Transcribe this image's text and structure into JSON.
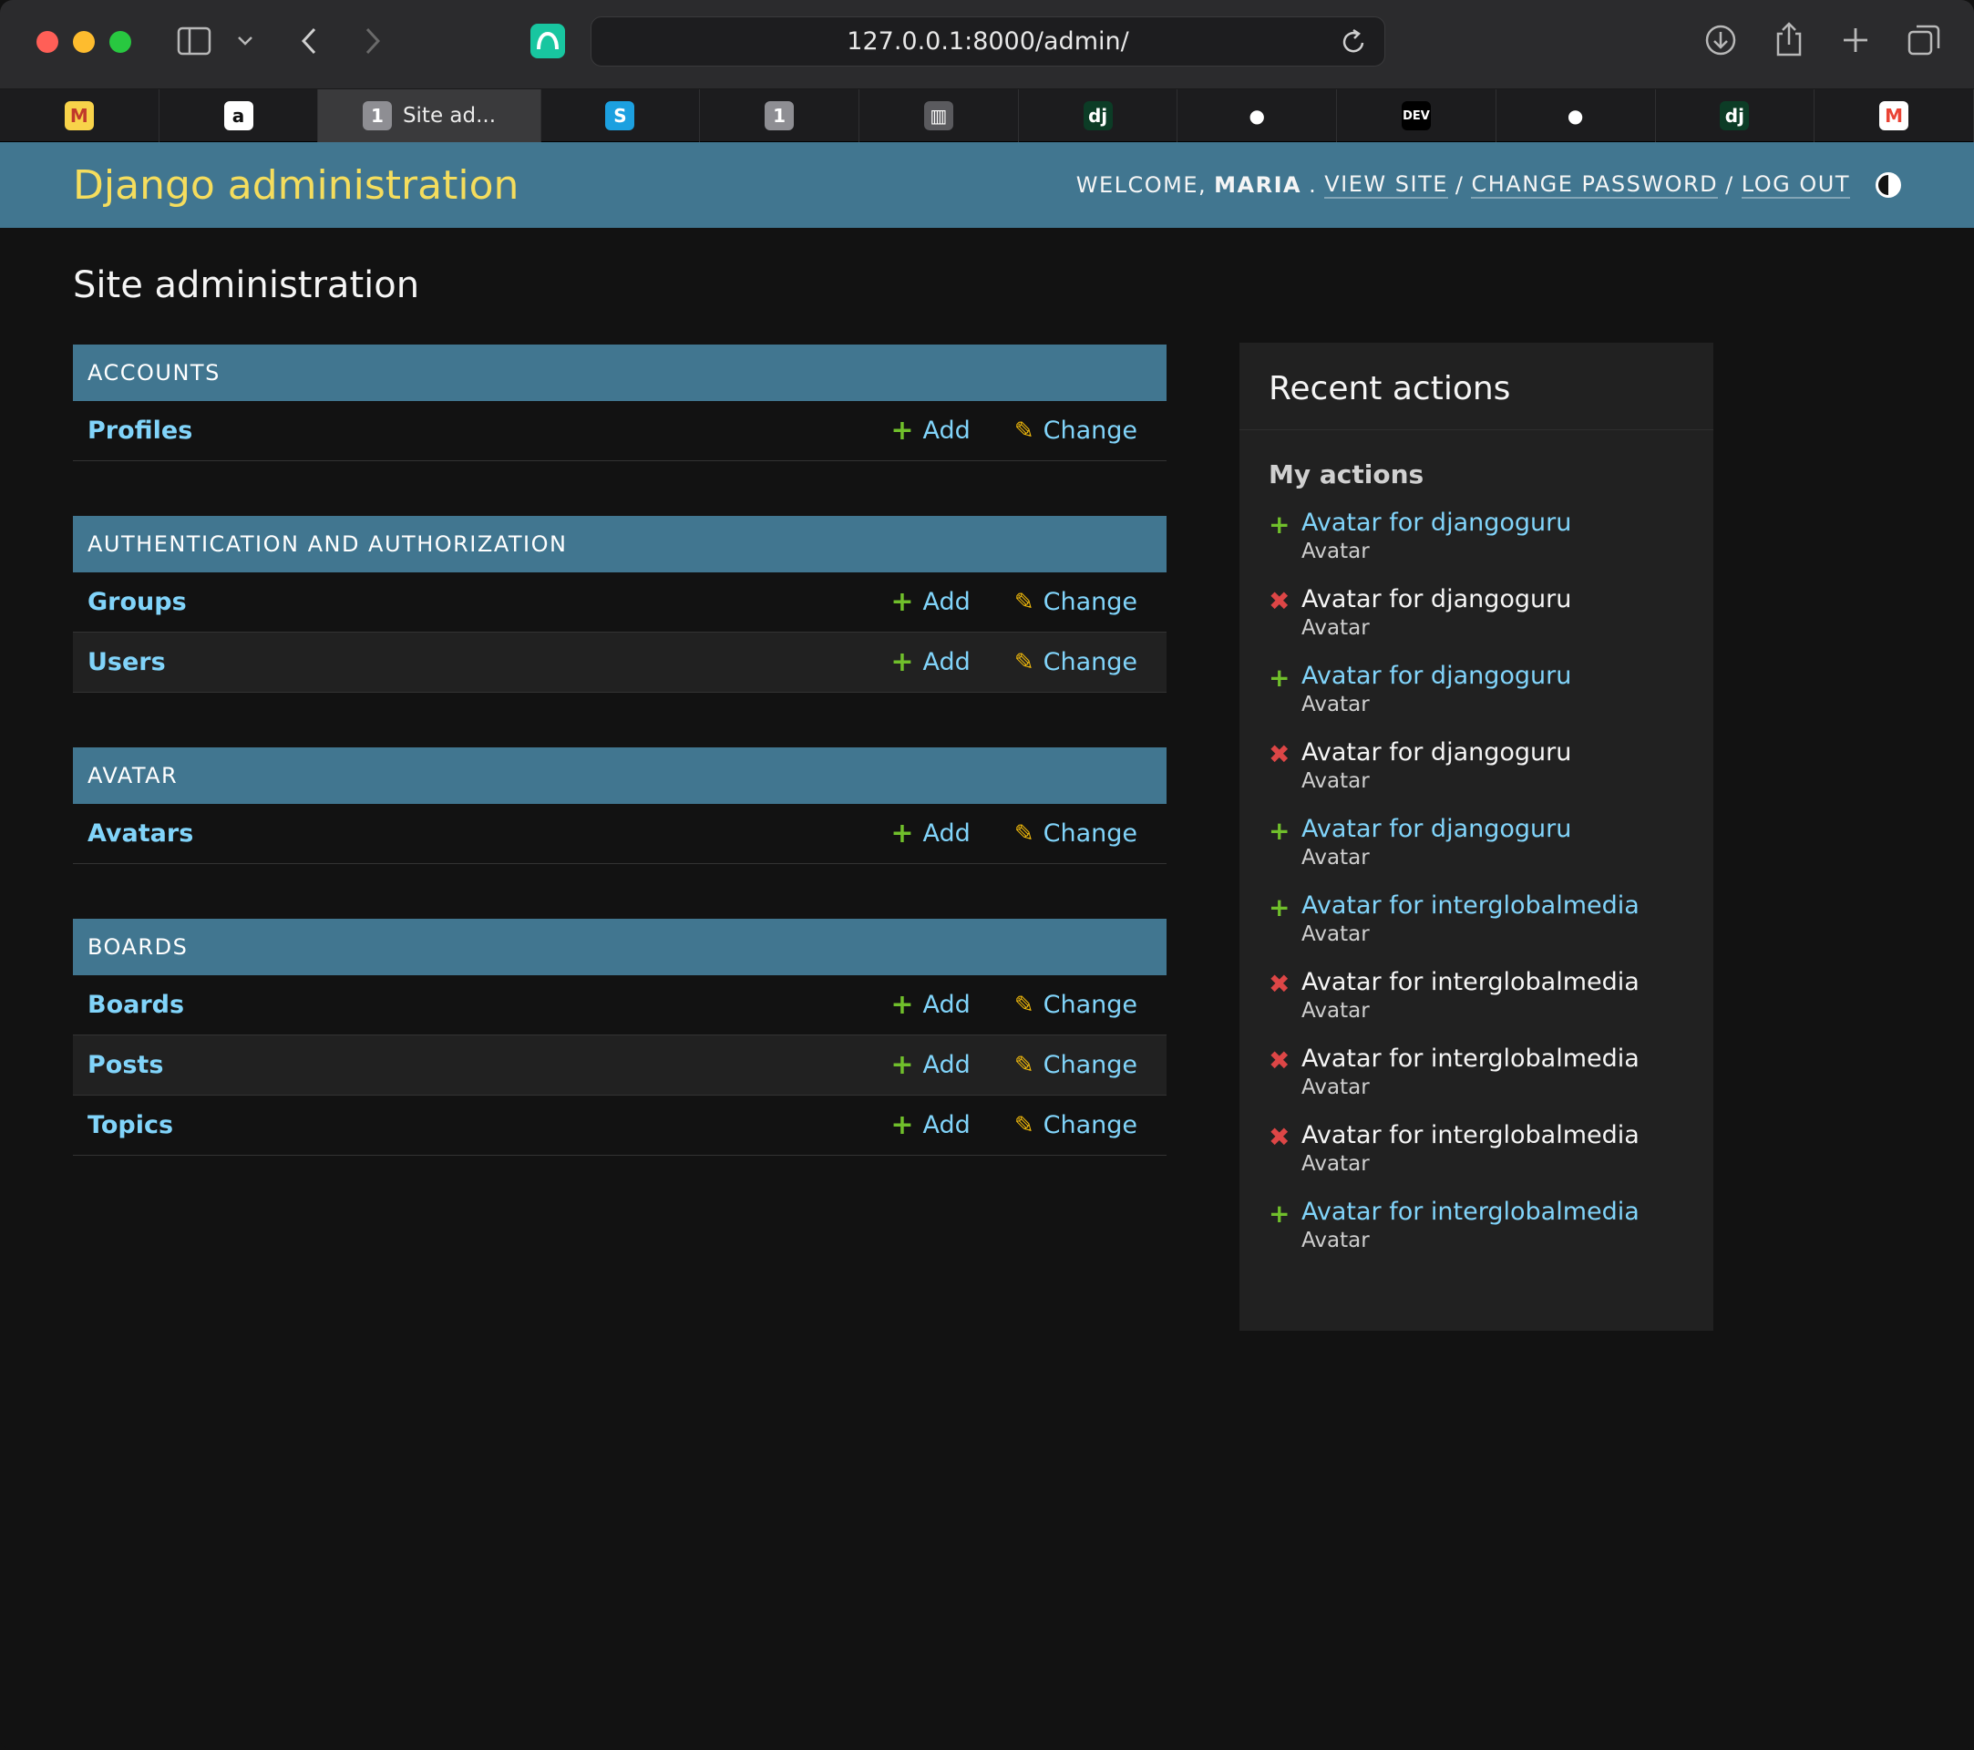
{
  "browser": {
    "url": "127.0.0.1:8000/admin/",
    "tabs": [
      {
        "icon": "medium-icon",
        "glyph": "M",
        "label": "",
        "active": false,
        "bg": "#f8d34a",
        "fg": "#c0392b"
      },
      {
        "icon": "amazon-icon",
        "glyph": "a",
        "label": "",
        "active": false,
        "bg": "#ffffff",
        "fg": "#111111"
      },
      {
        "icon": "tab-number-icon",
        "glyph": "1",
        "label": "Site ad...",
        "active": true,
        "bg": "#8e8e93",
        "fg": "#ffffff"
      },
      {
        "icon": "s-app-icon",
        "glyph": "S",
        "label": "",
        "active": false,
        "bg": "#1ca0e0",
        "fg": "#ffffff"
      },
      {
        "icon": "tab-number-icon",
        "glyph": "1",
        "label": "",
        "active": false,
        "bg": "#8e8e93",
        "fg": "#ffffff"
      },
      {
        "icon": "book-icon",
        "glyph": "▥",
        "label": "",
        "active": false,
        "bg": "#5a5a5e",
        "fg": "#ffffff"
      },
      {
        "icon": "django-icon",
        "glyph": "dj",
        "label": "",
        "active": false,
        "bg": "#0c3c26",
        "fg": "#ffffff"
      },
      {
        "icon": "github-icon",
        "glyph": "●",
        "label": "",
        "active": false,
        "bg": "transparent",
        "fg": "#ffffff"
      },
      {
        "icon": "dev-icon",
        "glyph": "DEV",
        "label": "",
        "active": false,
        "bg": "#000000",
        "fg": "#ffffff"
      },
      {
        "icon": "github-icon",
        "glyph": "●",
        "label": "",
        "active": false,
        "bg": "transparent",
        "fg": "#ffffff"
      },
      {
        "icon": "django-icon",
        "glyph": "dj",
        "label": "",
        "active": false,
        "bg": "#0c3c26",
        "fg": "#ffffff"
      },
      {
        "icon": "gmail-icon",
        "glyph": "M",
        "label": "",
        "active": false,
        "bg": "#ffffff",
        "fg": "#ea4335"
      }
    ]
  },
  "header": {
    "brand": "Django administration",
    "welcome": "WELCOME,",
    "username": "MARIA",
    "view_site": "VIEW SITE",
    "change_password": "CHANGE PASSWORD",
    "logout": "LOG OUT",
    "sep": "/"
  },
  "page_title": "Site administration",
  "add_label": "Add",
  "change_label": "Change",
  "apps": [
    {
      "name": "ACCOUNTS",
      "models": [
        "Profiles"
      ]
    },
    {
      "name": "AUTHENTICATION AND AUTHORIZATION",
      "models": [
        "Groups",
        "Users"
      ]
    },
    {
      "name": "AVATAR",
      "models": [
        "Avatars"
      ]
    },
    {
      "name": "BOARDS",
      "models": [
        "Boards",
        "Posts",
        "Topics"
      ]
    }
  ],
  "recent": {
    "title": "Recent actions",
    "subtitle": "My actions",
    "items": [
      {
        "action": "add",
        "title": "Avatar for djangoguru",
        "type": "Avatar"
      },
      {
        "action": "delete",
        "title": "Avatar for djangoguru",
        "type": "Avatar"
      },
      {
        "action": "add",
        "title": "Avatar for djangoguru",
        "type": "Avatar"
      },
      {
        "action": "delete",
        "title": "Avatar for djangoguru",
        "type": "Avatar"
      },
      {
        "action": "add",
        "title": "Avatar for djangoguru",
        "type": "Avatar"
      },
      {
        "action": "add",
        "title": "Avatar for interglobalmedia",
        "type": "Avatar"
      },
      {
        "action": "delete",
        "title": "Avatar for interglobalmedia",
        "type": "Avatar"
      },
      {
        "action": "delete",
        "title": "Avatar for interglobalmedia",
        "type": "Avatar"
      },
      {
        "action": "delete",
        "title": "Avatar for interglobalmedia",
        "type": "Avatar"
      },
      {
        "action": "add",
        "title": "Avatar for interglobalmedia",
        "type": "Avatar"
      }
    ]
  }
}
